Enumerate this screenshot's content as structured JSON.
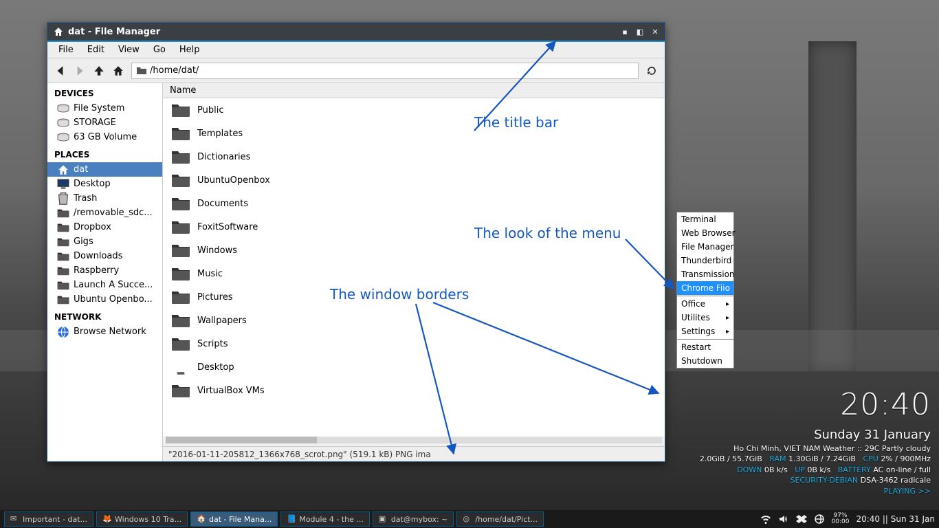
{
  "window": {
    "title": "dat - File Manager",
    "menubar": [
      "File",
      "Edit",
      "View",
      "Go",
      "Help"
    ],
    "path": "/home/dat/",
    "col_header": "Name",
    "statusbar": "\"2016-01-11-205812_1366x768_scrot.png\" (519.1 kB) PNG ima"
  },
  "sidebar": {
    "devices_label": "DEVICES",
    "devices": [
      "File System",
      "STORAGE",
      "63 GB Volume"
    ],
    "places_label": "PLACES",
    "places": [
      "dat",
      "Desktop",
      "Trash",
      "/removable_sdc...",
      "Dropbox",
      "Gigs",
      "Downloads",
      "Raspberry",
      "Launch A Succe...",
      "Ubuntu Openbo..."
    ],
    "places_selected": 0,
    "network_label": "NETWORK",
    "network": [
      "Browse Network"
    ]
  },
  "files": [
    "Public",
    "Templates",
    "Dictionaries",
    "UbuntuOpenbox",
    "Documents",
    "FoxitSoftware",
    "Windows",
    "Music",
    "Pictures",
    "Wallpapers",
    "Scripts",
    "Desktop",
    "VirtualBox VMs"
  ],
  "annotations": {
    "titlebar": "The title bar",
    "menu": "The look of the menu",
    "borders": "The window borders"
  },
  "context_menu": {
    "items": [
      "Terminal",
      "Web Browser",
      "File Manager",
      "Thunderbird",
      "Transmission",
      "Chrome Fiio",
      "Office",
      "Utilites",
      "Settings",
      "Restart",
      "Shutdown"
    ],
    "selected": 5,
    "submenu_idx": [
      6,
      7,
      8
    ],
    "sep_before": [
      6,
      9
    ]
  },
  "conky": {
    "clock": "20:40",
    "date": "Sunday 31 January",
    "weather": "Ho Chi Minh, VIET NAM Weather :: 29C Partly cloudy",
    "disk_label": "",
    "disk": "2.0GiB / 55.7GiB",
    "ram_label": "RAM",
    "ram": "1.30GiB / 7.24GiB",
    "cpu_label": "CPU",
    "cpu": "2% / 900MHz",
    "down_label": "DOWN",
    "down": "0B k/s",
    "up_label": "UP",
    "up": "0B k/s",
    "bat_label": "BATTERY",
    "bat": "AC on-line / full",
    "sec_label": "SECURITY-DEBIAN",
    "sec": "DSA-3462 radicale",
    "playing": "PLAYING >>"
  },
  "taskbar": {
    "items": [
      {
        "label": "Important - dat...",
        "active": false
      },
      {
        "label": "Windows 10 Tra...",
        "active": false
      },
      {
        "label": "dat - File Mana...",
        "active": true
      },
      {
        "label": "Module 4 - the ...",
        "active": false
      },
      {
        "label": "dat@mybox: ~",
        "active": false
      },
      {
        "label": "/home/dat/Pict...",
        "active": false
      }
    ],
    "battery_pct": "97%",
    "battery_time": "00:00",
    "tray_clock": "20:40 || Sun 31 Jan"
  }
}
